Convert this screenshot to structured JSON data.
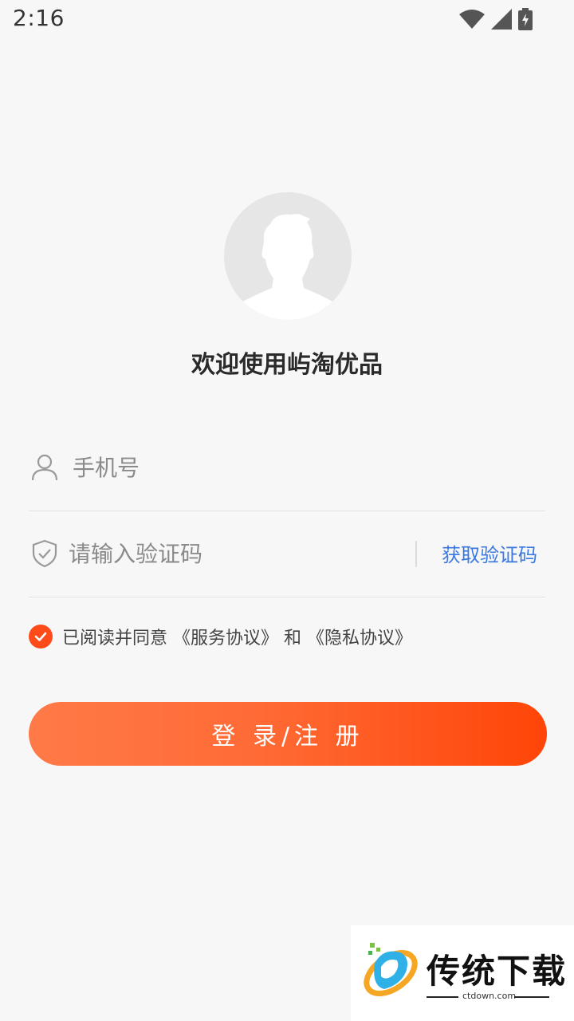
{
  "status_bar": {
    "time": "2:16",
    "icons": [
      "wifi-icon",
      "signal-icon",
      "battery-charging-icon"
    ]
  },
  "avatar": {
    "icon": "default-user-avatar"
  },
  "welcome_text": "欢迎使用屿淘优品",
  "phone_field": {
    "icon": "user-icon",
    "placeholder": "手机号",
    "value": ""
  },
  "code_field": {
    "icon": "shield-icon",
    "placeholder": "请输入验证码",
    "value": "",
    "get_code_label": "获取验证码"
  },
  "agreement": {
    "checked": true,
    "prefix": "已阅读并同意",
    "service_link": "《服务协议》",
    "and": "和",
    "privacy_link": "《隐私协议》"
  },
  "login_button": {
    "label": "登 录/注 册"
  },
  "watermark": {
    "title": "传统下载",
    "subtitle": "ctdown.com"
  },
  "colors": {
    "accent": "#ff4a1a",
    "link_blue": "#3a78e0",
    "background": "#f7f7f7"
  }
}
